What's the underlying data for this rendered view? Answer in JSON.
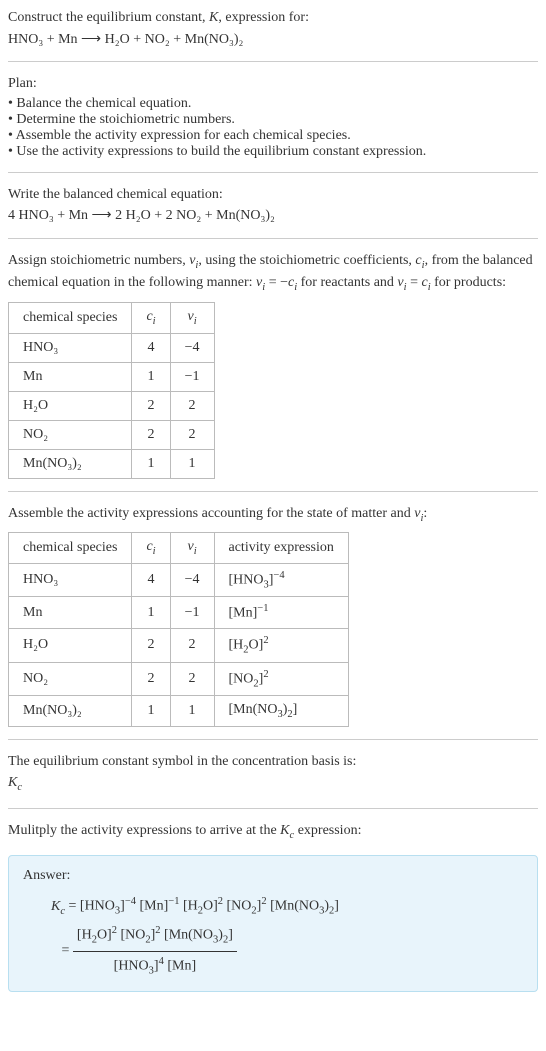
{
  "header": {
    "line1": "Construct the equilibrium constant, K, expression for:",
    "equation": "HNO₃ + Mn ⟶ H₂O + NO₂ + Mn(NO₃)₂"
  },
  "plan": {
    "title": "Plan:",
    "items": [
      "Balance the chemical equation.",
      "Determine the stoichiometric numbers.",
      "Assemble the activity expression for each chemical species.",
      "Use the activity expressions to build the equilibrium constant expression."
    ]
  },
  "balanced": {
    "title": "Write the balanced chemical equation:",
    "equation": "4 HNO₃ + Mn ⟶ 2 H₂O + 2 NO₂ + Mn(NO₃)₂"
  },
  "stoich": {
    "intro": "Assign stoichiometric numbers, νᵢ, using the stoichiometric coefficients, cᵢ, from the balanced chemical equation in the following manner: νᵢ = −cᵢ for reactants and νᵢ = cᵢ for products:",
    "headers": [
      "chemical species",
      "cᵢ",
      "νᵢ"
    ],
    "rows": [
      {
        "species": "HNO₃",
        "c": "4",
        "nu": "−4"
      },
      {
        "species": "Mn",
        "c": "1",
        "nu": "−1"
      },
      {
        "species": "H₂O",
        "c": "2",
        "nu": "2"
      },
      {
        "species": "NO₂",
        "c": "2",
        "nu": "2"
      },
      {
        "species": "Mn(NO₃)₂",
        "c": "1",
        "nu": "1"
      }
    ]
  },
  "activity": {
    "intro": "Assemble the activity expressions accounting for the state of matter and νᵢ:",
    "headers": [
      "chemical species",
      "cᵢ",
      "νᵢ",
      "activity expression"
    ],
    "rows": [
      {
        "species": "HNO₃",
        "c": "4",
        "nu": "−4",
        "act": "[HNO₃]⁻⁴"
      },
      {
        "species": "Mn",
        "c": "1",
        "nu": "−1",
        "act": "[Mn]⁻¹"
      },
      {
        "species": "H₂O",
        "c": "2",
        "nu": "2",
        "act": "[H₂O]²"
      },
      {
        "species": "NO₂",
        "c": "2",
        "nu": "2",
        "act": "[NO₂]²"
      },
      {
        "species": "Mn(NO₃)₂",
        "c": "1",
        "nu": "1",
        "act": "[Mn(NO₃)₂]"
      }
    ]
  },
  "eqconst": {
    "line1": "The equilibrium constant symbol in the concentration basis is:",
    "symbol": "K𝒸"
  },
  "multiply": {
    "text": "Mulitply the activity expressions to arrive at the K𝒸 expression:"
  },
  "answer": {
    "label": "Answer:",
    "line1": "K𝒸 = [HNO₃]⁻⁴ [Mn]⁻¹ [H₂O]² [NO₂]² [Mn(NO₃)₂]",
    "frac_num": "[H₂O]² [NO₂]² [Mn(NO₃)₂]",
    "frac_den": "[HNO₃]⁴ [Mn]"
  }
}
